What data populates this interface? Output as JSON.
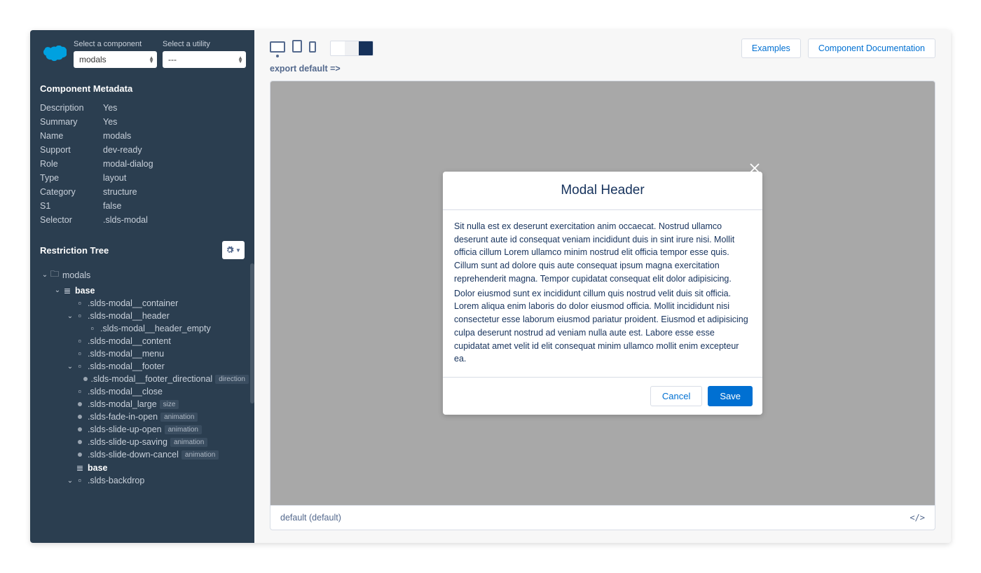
{
  "sidebar": {
    "selectComponentLabel": "Select a component",
    "selectUtilityLabel": "Select a utility",
    "componentValue": "modals",
    "utilityValue": "---",
    "metadataTitle": "Component Metadata",
    "metadata": {
      "Description": "Yes",
      "Summary": "Yes",
      "Name": "modals",
      "Support": "dev-ready",
      "Role": "modal-dialog",
      "Type": "layout",
      "Category": "structure",
      "S1": "false",
      "Selector": ".slds-modal"
    },
    "restrictionTitle": "Restriction Tree",
    "tree": {
      "root": "modals",
      "base": "base",
      "container": ".slds-modal__container",
      "header": ".slds-modal__header",
      "headerEmpty": ".slds-modal__header_empty",
      "content": ".slds-modal__content",
      "menu": ".slds-modal__menu",
      "footer": ".slds-modal__footer",
      "footerDirectional": ".slds-modal__footer_directional",
      "footerDirectionalBadge": "direction",
      "close": ".slds-modal__close",
      "large": ".slds-modal_large",
      "largeBadge": "size",
      "fadeIn": ".slds-fade-in-open",
      "slideUpOpen": ".slds-slide-up-open",
      "slideUpSaving": ".slds-slide-up-saving",
      "slideDownCancel": ".slds-slide-down-cancel",
      "animationBadge": "animation",
      "base2": "base",
      "backdrop": ".slds-backdrop"
    }
  },
  "toolbar": {
    "examples": "Examples",
    "documentation": "Component Documentation",
    "exportLine": "export default =>"
  },
  "modal": {
    "header": "Modal Header",
    "para1": "Sit nulla est ex deserunt exercitation anim occaecat. Nostrud ullamco deserunt aute id consequat veniam incididunt duis in sint irure nisi. Mollit officia cillum Lorem ullamco minim nostrud elit officia tempor esse quis. Cillum sunt ad dolore quis aute consequat ipsum magna exercitation reprehenderit magna. Tempor cupidatat consequat elit dolor adipisicing.",
    "para2": "Dolor eiusmod sunt ex incididunt cillum quis nostrud velit duis sit officia. Lorem aliqua enim laboris do dolor eiusmod officia. Mollit incididunt nisi consectetur esse laborum eiusmod pariatur proident. Eiusmod et adipisicing culpa deserunt nostrud ad veniam nulla aute est. Labore esse esse cupidatat amet velit id elit consequat minim ullamco mollit enim excepteur ea.",
    "cancel": "Cancel",
    "save": "Save"
  },
  "previewFooter": {
    "variant": "default (default)",
    "codeIcon": "</>"
  }
}
